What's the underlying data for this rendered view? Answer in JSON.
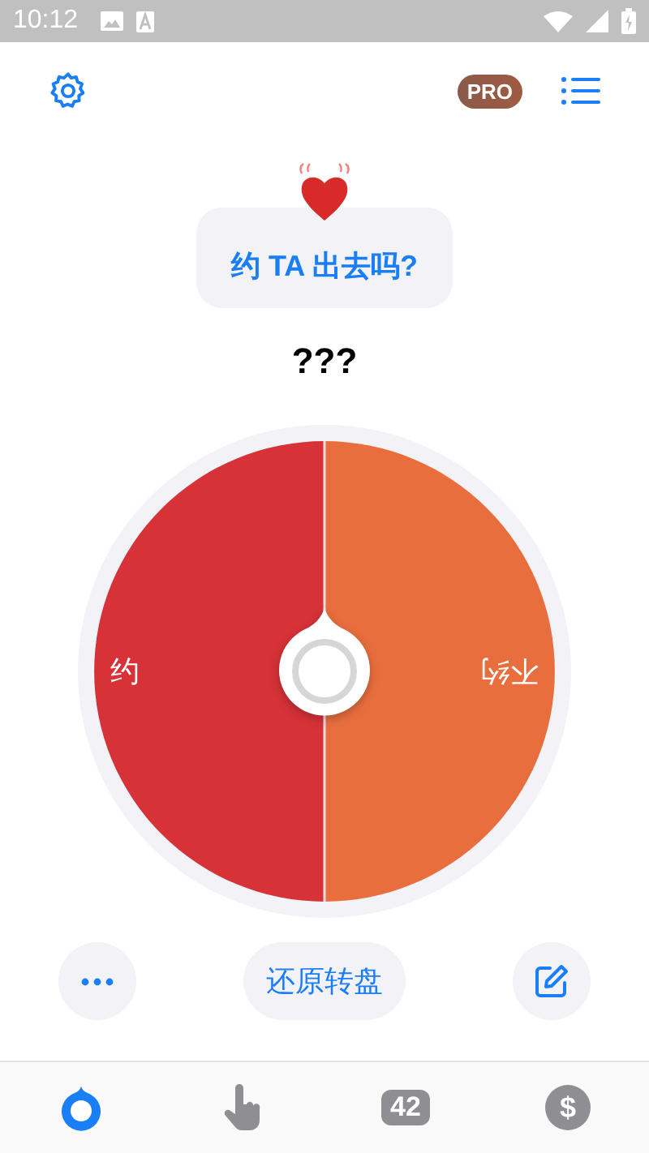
{
  "status_bar": {
    "time": "10:12"
  },
  "header": {
    "badge": "PRO"
  },
  "question": {
    "text": "约 TA 出去吗?"
  },
  "result": "???",
  "wheel": {
    "segments": [
      {
        "label": "约",
        "color": "#d63238"
      },
      {
        "label": "不约",
        "color": "#e96e3e"
      }
    ]
  },
  "actions": {
    "reset": "还原转盘"
  },
  "tabs": [
    {
      "kind": "wheel",
      "selected": true
    },
    {
      "kind": "tap",
      "selected": false
    },
    {
      "kind": "number",
      "label": "42",
      "selected": false
    },
    {
      "kind": "dollar",
      "label": "$",
      "selected": false
    }
  ]
}
